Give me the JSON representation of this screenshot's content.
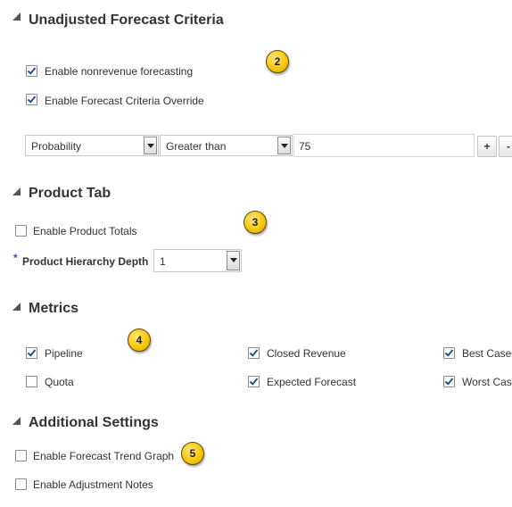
{
  "sections": {
    "unadjusted": {
      "title": "Unadjusted Forecast Criteria",
      "badge": "2",
      "enable_nonrevenue": {
        "label": "Enable nonrevenue forecasting",
        "checked": true
      },
      "enable_override": {
        "label": "Enable Forecast Criteria Override",
        "checked": true
      },
      "criteria_row": {
        "field": "Probability",
        "operator": "Greater than",
        "value": "75",
        "add_label": "+",
        "remove_label": "-"
      }
    },
    "product_tab": {
      "title": "Product Tab",
      "badge": "3",
      "enable_product_totals": {
        "label": "Enable Product Totals",
        "checked": false
      },
      "hierarchy_depth": {
        "required_mark": "*",
        "label": "Product Hierarchy Depth",
        "value": "1"
      }
    },
    "metrics": {
      "title": "Metrics",
      "badge": "4",
      "items": [
        {
          "label": "Pipeline",
          "checked": true
        },
        {
          "label": "Closed Revenue",
          "checked": true
        },
        {
          "label": "Best Case",
          "checked": true
        },
        {
          "label": "Quota",
          "checked": false
        },
        {
          "label": "Expected Forecast",
          "checked": true
        },
        {
          "label": "Worst Case",
          "checked": true
        }
      ]
    },
    "additional": {
      "title": "Additional Settings",
      "badge": "5",
      "enable_trend_graph": {
        "label": "Enable Forecast Trend Graph",
        "checked": false
      },
      "enable_adjustment_notes": {
        "label": "Enable Adjustment Notes",
        "checked": false
      }
    }
  },
  "colors": {
    "checkmark": "#2a4f8e",
    "badge": "#f5c400",
    "required": "#2a5aa8"
  }
}
